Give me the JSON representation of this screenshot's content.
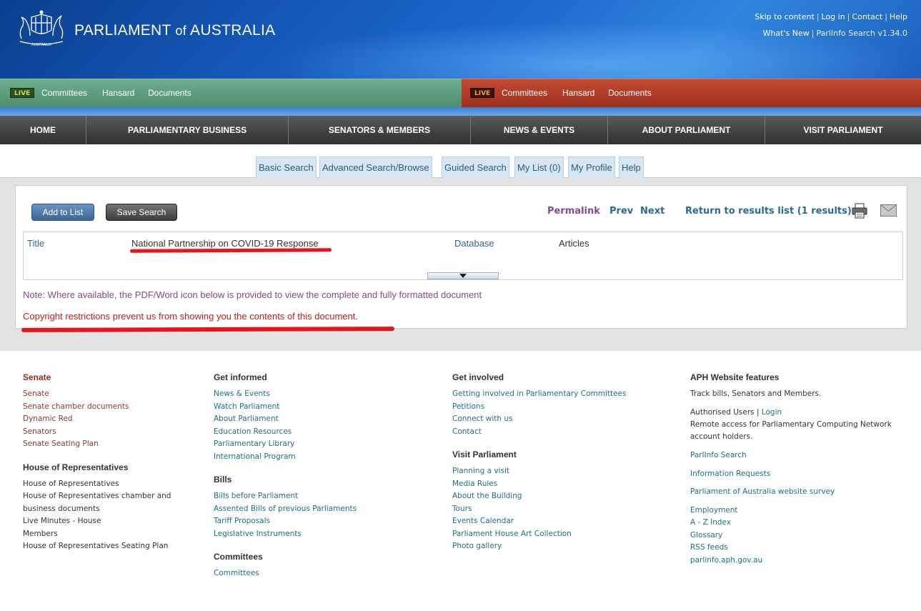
{
  "header": {
    "title_main": "PARLIAMENT",
    "title_of": "of",
    "title_country": "AUSTRALIA",
    "crest_text": "AUSTRALIA",
    "util_links": [
      "Skip to content",
      "Log in",
      "Contact",
      "Help"
    ],
    "whats_new": "What's New",
    "version": "ParlInfo Search v1.34.0"
  },
  "livebar": {
    "senate": {
      "badge": "LIVE",
      "links": [
        "Committees",
        "Hansard",
        "Documents"
      ]
    },
    "house": {
      "badge": "LIVE",
      "links": [
        "Committees",
        "Hansard",
        "Documents"
      ]
    }
  },
  "mainnav": [
    "HOME",
    "PARLIAMENTARY BUSINESS",
    "SENATORS & MEMBERS",
    "NEWS & EVENTS",
    "ABOUT PARLIAMENT",
    "VISIT PARLIAMENT"
  ],
  "search_tabs": [
    "Basic Search",
    "Advanced Search/Browse",
    "Guided Search",
    "My List (0)",
    "My Profile",
    "Help"
  ],
  "result": {
    "add_to_list": "Add to List",
    "save_search": "Save Search",
    "permalink": "Permalink",
    "prev": "Prev",
    "next": "Next",
    "return_link": "Return to results list (1 results)",
    "title_label": "Title",
    "title_value": "National Partnership on COVID-19 Response",
    "database_label": "Database",
    "database_value": "Articles",
    "note": "Note: Where available, the PDF/Word icon below is provided to view the complete and fully formatted document",
    "copyright": "Copyright restrictions prevent us from showing you the contents of this document."
  },
  "footer": {
    "senate": {
      "heading": "Senate",
      "links": [
        "Senate",
        "Senate chamber documents",
        "Dynamic Red",
        "Senators",
        "Senate Seating Plan"
      ]
    },
    "house": {
      "heading": "House of Representatives",
      "links": [
        "House of Representatives",
        "House of Representatives chamber and",
        "business documents",
        "Live Minutes - House",
        "Members",
        "House of Representatives Seating Plan"
      ]
    },
    "get_informed": {
      "heading": "Get informed",
      "links": [
        "News & Events",
        "Watch Parliament",
        "About Parliament",
        "Education Resources",
        "Parliamentary Library",
        "International Program"
      ]
    },
    "bills": {
      "heading": "Bills",
      "links": [
        "Bills before Parliament",
        "Assented Bills of previous Parliaments",
        "Tariff Proposals",
        "Legislative Instruments"
      ]
    },
    "committees": {
      "heading": "Committees",
      "links": [
        "Committees"
      ]
    },
    "get_involved": {
      "heading": "Get involved",
      "links": [
        "Getting involved in Parliamentary Committees",
        "Petitions",
        "Connect with us",
        "Contact"
      ]
    },
    "visit": {
      "heading": "Visit Parliament",
      "links": [
        "Planning a visit",
        "Media Rules",
        "About the Building",
        "Tours",
        "Events Calendar",
        "Parliament House Art Collection",
        "Photo gallery"
      ]
    },
    "aph": {
      "heading": "APH Website features",
      "track": "Track bills, Senators and Members.",
      "auth_prefix": "Authorised Users |",
      "login": "Login",
      "remote_1": "Remote access for Parliamentary Computing Network",
      "remote_2": "account holders.",
      "links_a": [
        "ParlInfo Search"
      ],
      "links_b": [
        "Information Requests"
      ],
      "links_c": [
        "Parliament of Australia website survey"
      ],
      "links_d": [
        "Employment",
        "A - Z Index",
        "Glossary",
        "RSS feeds",
        "parlinfo.aph.gov.au"
      ]
    }
  }
}
